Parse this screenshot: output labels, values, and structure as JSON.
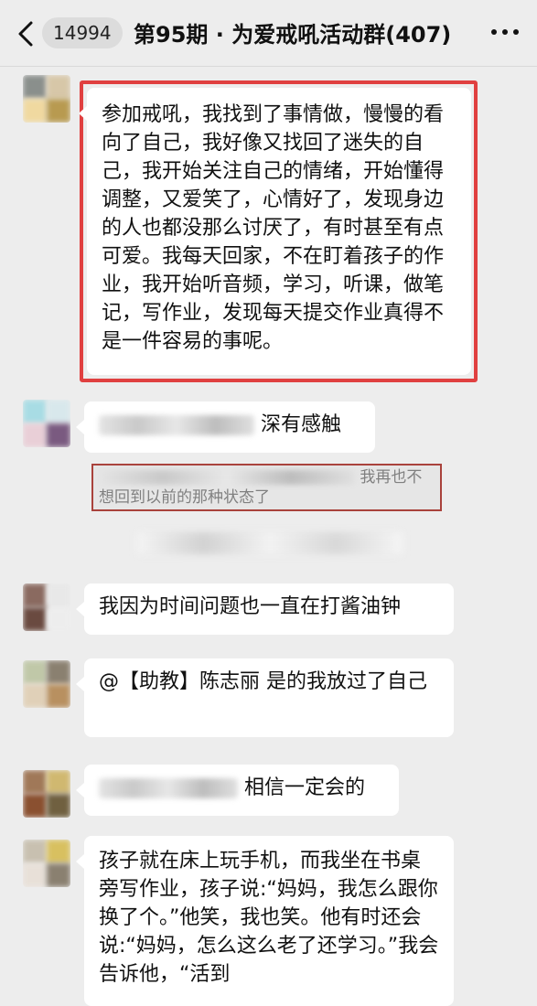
{
  "header": {
    "back_label": "<",
    "unread_count": "14994",
    "title": "第95期 · 为爱戒吼活动群(407)"
  },
  "messages": [
    {
      "text": "参加戒吼，我找到了事情做，慢慢的看向了自己，我好像又找回了迷失的自己，我开始关注自己的情绪，开始懂得调整，又爱笑了，心情好了，发现身边的人也都没那么讨厌了，有时甚至有点可爱。我每天回家，不在盯着孩子的作业，我开始听音频，学习，听课，做笔记，写作业，发现每天提交作业真得不是一件容易的事呢。"
    },
    {
      "text": "深有感触",
      "quote": "我再也不想回到以前的那种状态了"
    },
    {
      "text": "我因为时间问题也一直在打酱油钟"
    },
    {
      "text": "@【助教】陈志丽 是的我放过了自己"
    },
    {
      "text": "相信一定会的"
    },
    {
      "text": "孩子就在床上玩手机，而我坐在书桌旁写作业，孩子说:“妈妈，我怎么跟你换了个。”他笑，我也笑。他有时还会说:“妈妈，怎么这么老了还学习。”我会告诉他，“活到"
    }
  ],
  "colors": {
    "highlight_border": "#e04040",
    "quote_border": "#a9423c",
    "background": "#ededed"
  }
}
